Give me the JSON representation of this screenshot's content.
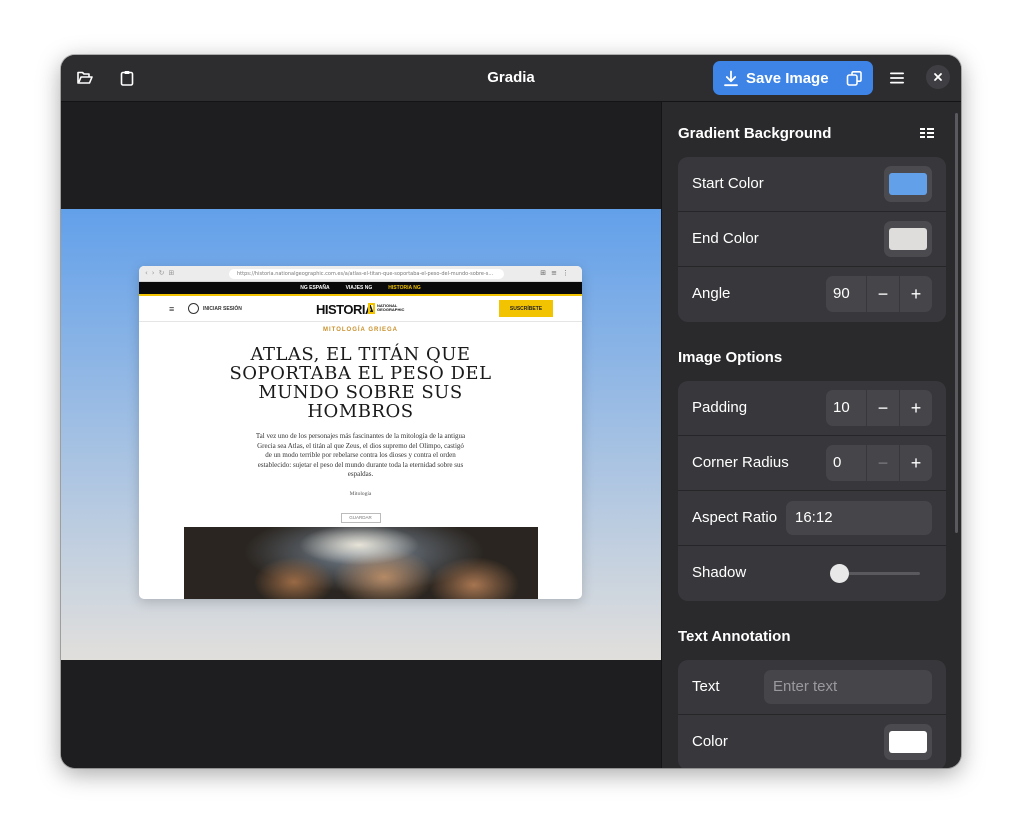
{
  "window": {
    "title": "Gradia",
    "save_label": "Save Image"
  },
  "icons": {
    "open": "folder-open-icon",
    "paste": "clipboard-icon",
    "save": "download-icon",
    "copy": "copy-icon",
    "menu": "hamburger-menu-icon",
    "close": "close-icon",
    "presets": "presets-grid-icon"
  },
  "colors": {
    "accent": "#3d84e6",
    "start_color": "#62a0ea",
    "end_color": "#dedddb",
    "annotation_color": "#ffffff"
  },
  "gradient": {
    "section_title": "Gradient Background",
    "start_label": "Start Color",
    "end_label": "End Color",
    "angle_label": "Angle",
    "angle_value": "90"
  },
  "image_options": {
    "section_title": "Image Options",
    "padding_label": "Padding",
    "padding_value": "10",
    "radius_label": "Corner Radius",
    "radius_value": "0",
    "aspect_label": "Aspect Ratio",
    "aspect_value": "16:12",
    "shadow_label": "Shadow",
    "shadow_level": 0
  },
  "text_annotation": {
    "section_title": "Text Annotation",
    "text_label": "Text",
    "text_placeholder": "Enter text",
    "color_label": "Color"
  },
  "preview": {
    "url": "https://historia.nationalgeographic.com.es/a/atlas-el-titan-que-soportaba-el-peso-del-mundo-sobre-s...",
    "top_links": [
      "NG ESPAÑA",
      "VIAJES NG",
      "HISTORIA NG"
    ],
    "login": "INICIAR SESIÓN",
    "logo": "HISTORIA",
    "logo_sub": "NATIONAL GEOGRAPHIC",
    "subscribe": "SUSCRÍBETE",
    "kicker": "MITOLOGÍA GRIEGA",
    "headline": "ATLAS, EL TITÁN QUE SOPORTABA EL PESO DEL MUNDO SOBRE SUS HOMBROS",
    "lead": "Tal vez uno de los personajes más fascinantes de la mitología de la antigua Grecia sea Atlas, el titán al que Zeus, el dios supremo del Olimpo, castigó de un modo terrible por rebelarse contra los dioses y contra el orden establecido: sujetar el peso del mundo durante toda la eternidad sobre sus espaldas.",
    "tag": "Mitología",
    "save": "GUARDAR"
  }
}
